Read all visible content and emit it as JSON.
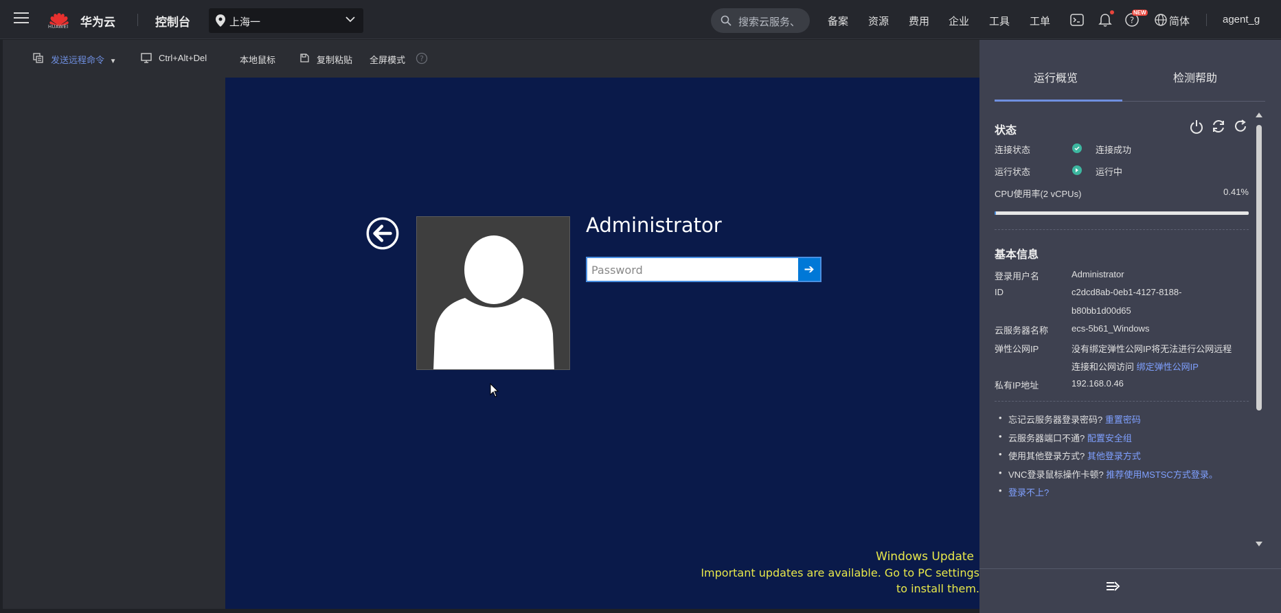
{
  "topbar": {
    "brand": "华为云",
    "logo_text": "HUAWEI",
    "console": "控制台",
    "region": "上海一",
    "search_placeholder": "搜索云服务、",
    "nav": [
      "备案",
      "资源",
      "费用",
      "企业",
      "工具",
      "工单"
    ],
    "new_badge": "NEW",
    "language": "简体",
    "user": "agent_g"
  },
  "toolbar": {
    "send_command": "发送远程命令",
    "ctrl_alt_del": "Ctrl+Alt+Del",
    "local_mouse": "本地鼠标",
    "copy_paste": "复制粘贴",
    "fullscreen": "全屏模式"
  },
  "vm": {
    "username": "Administrator",
    "password_placeholder": "Password",
    "update_title": "Windows Update",
    "update_text": "Important updates are available. Go to PC settings to install them."
  },
  "panel": {
    "tabs": [
      "运行概览",
      "检测帮助"
    ],
    "status_title": "状态",
    "conn_label": "连接状态",
    "conn_value": "连接成功",
    "run_label": "运行状态",
    "run_value": "运行中",
    "cpu_label": "CPU使用率(2 vCPUs)",
    "cpu_value": "0.41%",
    "cpu_fraction": 0.0041,
    "basic_title": "基本信息",
    "login_user_label": "登录用户名",
    "login_user_value": "Administrator",
    "id_label": "ID",
    "id_value_1": "c2dcd8ab-0eb1-4127-8188-",
    "id_value_2": "b80bb1d00d65",
    "server_name_label": "云服务器名称",
    "server_name_value": "ecs-5b61_Windows",
    "eip_label": "弹性公网IP",
    "eip_text_1": "没有绑定弹性公网IP将无法进行公网远程",
    "eip_text_2": "连接和公网访问",
    "eip_link": "绑定弹性公网IP",
    "private_ip_label": "私有IP地址",
    "private_ip_value": "192.168.0.46",
    "help": [
      {
        "text": "忘记云服务器登录密码?",
        "link": "重置密码"
      },
      {
        "text": "云服务器端口不通?",
        "link": "配置安全组"
      },
      {
        "text": "使用其他登录方式?",
        "link": "其他登录方式"
      },
      {
        "text": "VNC登录鼠标操作卡顿?",
        "link": "推荐使用MSTSC方式登录。"
      },
      {
        "text": "",
        "link": "登录不上?"
      }
    ]
  },
  "colors": {
    "accent": "#6f8fe0",
    "link": "#7fa0ff",
    "ok": "#3db7a0",
    "vm_bg": "#0a1a4a",
    "windows_blue": "#0078d7",
    "warning_yellow": "#e8e84a"
  },
  "icons": {
    "menu": "hamburger-icon",
    "location": "map-pin-icon",
    "search": "search-icon",
    "terminal": "terminal-icon",
    "bell": "bell-icon",
    "help": "question-icon",
    "globe": "globe-icon"
  }
}
